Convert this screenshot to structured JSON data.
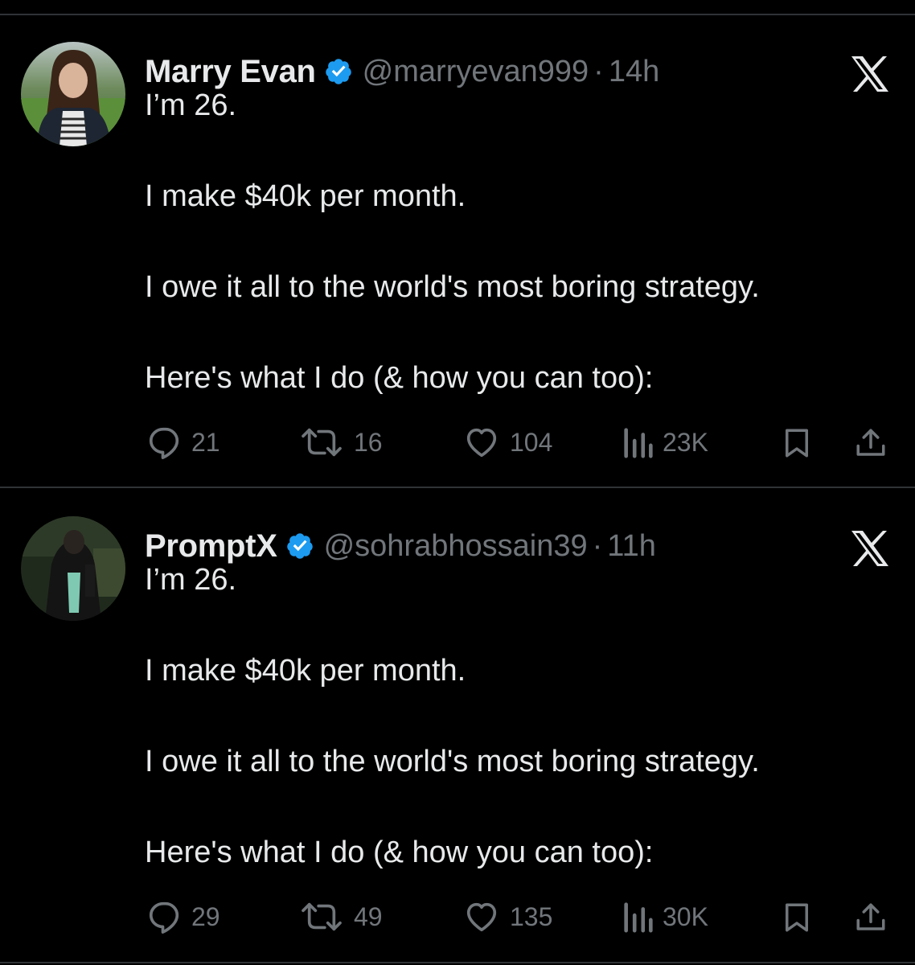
{
  "tweets": [
    {
      "author_name": "Marry Evan",
      "handle": "@marryevan999",
      "separator": "·",
      "time": "14h",
      "lines": [
        "I’m 26.",
        "I make $40k per month.",
        "I owe it all to the world's most boring strategy.",
        "Here's what I do (& how you can too):"
      ],
      "stats": {
        "replies": "21",
        "reposts": "16",
        "likes": "104",
        "views": "23K"
      }
    },
    {
      "author_name": "PromptX",
      "handle": "@sohrabhossain39",
      "separator": "·",
      "time": "11h",
      "lines": [
        "I’m 26.",
        "I make $40k per month.",
        "I owe it all to the world's most boring strategy.",
        "Here's what I do (& how you can too):"
      ],
      "stats": {
        "replies": "29",
        "reposts": "49",
        "likes": "135",
        "views": "30K"
      }
    }
  ],
  "icons": {
    "verified": "verified-badge-icon",
    "brand": "x-logo-icon",
    "reply": "reply-icon",
    "repost": "repost-icon",
    "like": "heart-icon",
    "views": "views-chart-icon",
    "bookmark": "bookmark-icon",
    "share": "share-icon"
  },
  "colors": {
    "background": "#000000",
    "text": "#e7e9ea",
    "muted": "#71767b",
    "verified": "#1d9bf0",
    "divider": "#2f3336"
  }
}
